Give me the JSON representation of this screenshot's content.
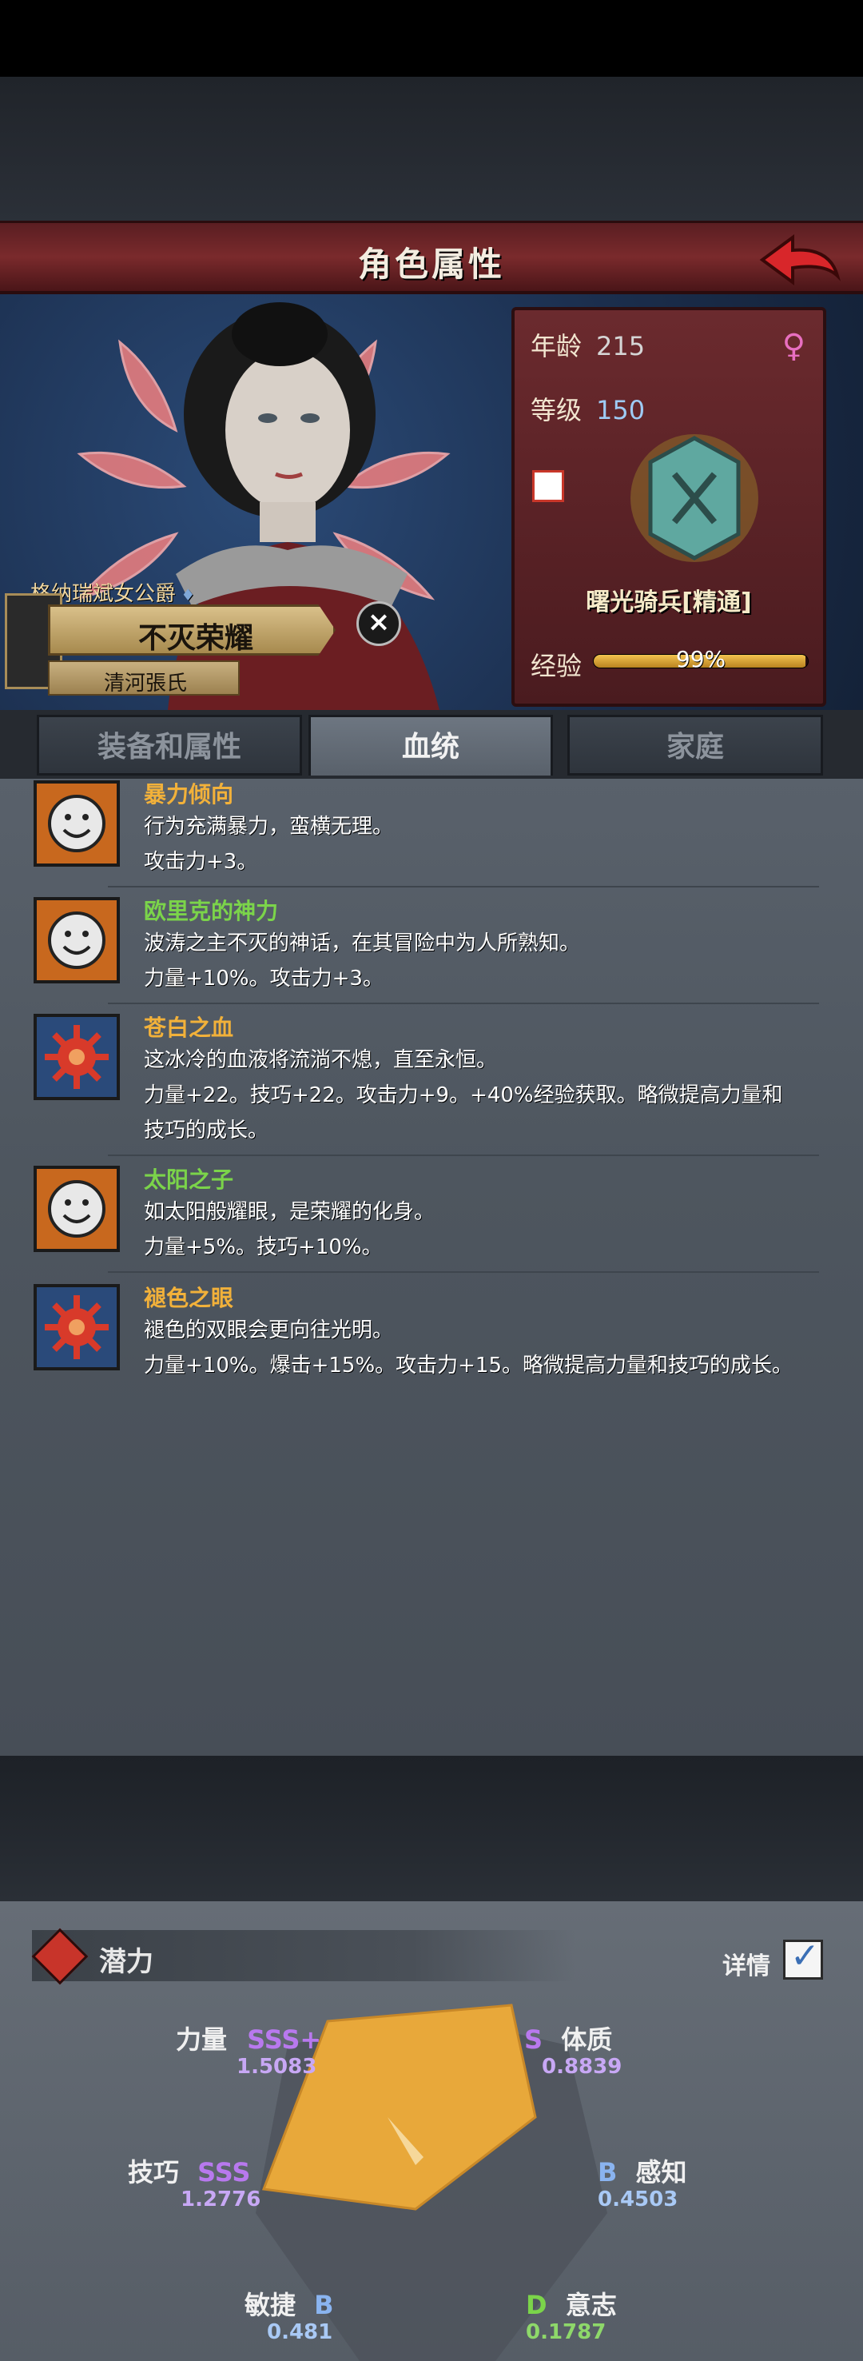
{
  "screen_title": "角色属性",
  "character": {
    "rank": "格纳瑞斌女公爵",
    "name": "不灭荣耀",
    "clan": "清河張氏",
    "age_label": "年龄",
    "age": "215",
    "level_label": "等级",
    "level": "150",
    "unit": "曙光骑兵[精通]",
    "exp_label": "经验",
    "exp_percent": "99%",
    "exp_fraction": 0.99,
    "gender_icon": "female-symbol-icon"
  },
  "tabs": [
    "装备和属性",
    "血统",
    "家庭"
  ],
  "active_tab_index": 1,
  "traits": [
    {
      "name": "暴力倾向",
      "color": "#f2b13a",
      "icon": "smiley-face-icon",
      "lines": [
        "行为充满暴力，蛮横无理。",
        "攻击力+3。"
      ]
    },
    {
      "name": "欧里克的神力",
      "color": "#7bd44a",
      "icon": "smiley-face-icon",
      "lines": [
        "波涛之主不灭的神话，在其冒险中为人所熟知。",
        "力量+10%。攻击力+3。"
      ]
    },
    {
      "name": "苍白之血",
      "color": "#f2b13a",
      "icon": "red-sun-emblem-icon",
      "lines": [
        "这冰冷的血液将流淌不熄，直至永恒。",
        "力量+22。技巧+22。攻击力+9。+40%经验获取。略微提高力量和",
        "技巧的成长。"
      ]
    },
    {
      "name": "太阳之子",
      "color": "#7bd44a",
      "icon": "smiley-face-icon",
      "lines": [
        "如太阳般耀眼，是荣耀的化身。",
        "力量+5%。技巧+10%。"
      ]
    },
    {
      "name": "褪色之眼",
      "color": "#f2b13a",
      "icon": "red-sun-emblem-icon",
      "lines": [
        "褪色的双眼会更向往光明。",
        "力量+10%。爆击+15%。攻击力+15。略微提高力量和技巧的成长。"
      ]
    }
  ],
  "potential": {
    "title": "潜力",
    "detail_label": "详情",
    "detail_checked": true,
    "attributes": [
      {
        "name": "力量",
        "grade": "SSS+",
        "value": "1.5083"
      },
      {
        "name": "体质",
        "grade": "S",
        "value": "0.8839"
      },
      {
        "name": "感知",
        "grade": "B",
        "value": "0.4503"
      },
      {
        "name": "意志",
        "grade": "D",
        "value": "0.1787"
      },
      {
        "name": "敏捷",
        "grade": "B",
        "value": "0.481"
      },
      {
        "name": "技巧",
        "grade": "SSS",
        "value": "1.2776"
      }
    ]
  },
  "colors": {
    "title_bar": "#7a2a2c",
    "radar_fill": "#e8a83a",
    "grade_purple": "#b879ee"
  }
}
